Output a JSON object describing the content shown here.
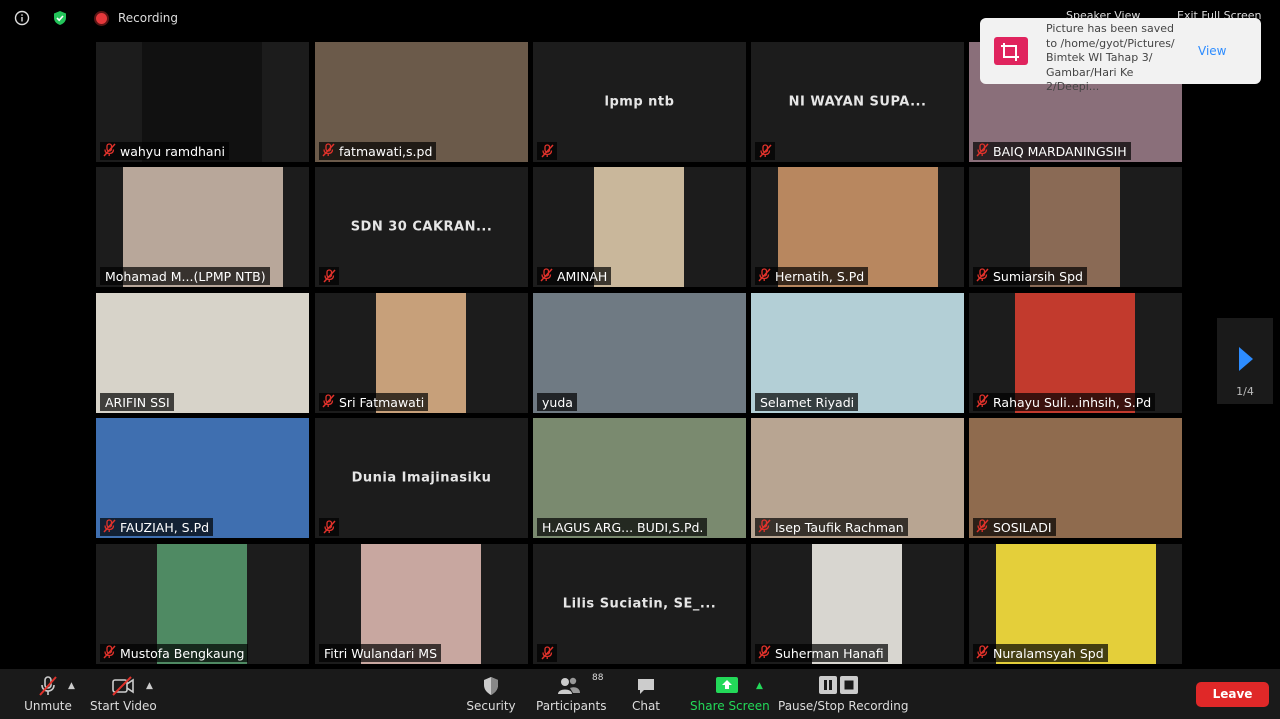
{
  "topbar": {
    "recording_label": "Recording",
    "speaker_view_label": "Speaker View",
    "exit_fullscreen_label": "Exit Full Screen"
  },
  "toast": {
    "message": "Picture has been saved to /home/gyot/Pictures/ Bimtek WI Tahap 3/ Gambar/Hari Ke 2/Deepi...",
    "view_label": "View"
  },
  "pagination": {
    "label": "1/4"
  },
  "participants": [
    {
      "name": "wahyu ramdhani",
      "muted": true
    },
    {
      "name": "fatmawati,s.pd",
      "muted": true
    },
    {
      "name": "",
      "center_name": "lpmp ntb",
      "muted": true
    },
    {
      "name": "",
      "center_name": "NI WAYAN SUPA...",
      "muted": true
    },
    {
      "name": "BAIQ MARDANINGSIH",
      "muted": true
    },
    {
      "name": "Mohamad M...(LPMP NTB)",
      "muted": false
    },
    {
      "name": "",
      "center_name": "SDN 30 CAKRAN...",
      "muted": true
    },
    {
      "name": "AMINAH",
      "muted": true
    },
    {
      "name": "Hernatih, S.Pd",
      "muted": true
    },
    {
      "name": "Sumiarsih Spd",
      "muted": true
    },
    {
      "name": "ARIFIN SSI",
      "muted": false
    },
    {
      "name": "Sri Fatmawati",
      "muted": true
    },
    {
      "name": "yuda",
      "muted": false
    },
    {
      "name": "Selamet Riyadi",
      "muted": false,
      "active_speaker": true
    },
    {
      "name": "Rahayu Suli...inhsih, S.Pd",
      "muted": true
    },
    {
      "name": "FAUZIAH, S.Pd",
      "muted": true
    },
    {
      "name": "",
      "center_name": "Dunia Imajinasiku",
      "muted": true
    },
    {
      "name": "H.AGUS ARG... BUDI,S.Pd.",
      "muted": false
    },
    {
      "name": "Isep Taufik Rachman",
      "muted": true
    },
    {
      "name": "SOSILADI",
      "muted": true
    },
    {
      "name": "Mustofa Bengkaung",
      "muted": true
    },
    {
      "name": "Fitri Wulandari MS",
      "muted": false
    },
    {
      "name": "",
      "center_name": "Lilis Suciatin, SE_...",
      "muted": true
    },
    {
      "name": "Suherman Hanafi",
      "muted": true
    },
    {
      "name": "Nuralamsyah Spd",
      "muted": true
    }
  ],
  "toolbar": {
    "unmute": "Unmute",
    "start_video": "Start Video",
    "security": "Security",
    "participants": "Participants",
    "participants_count": "88",
    "chat": "Chat",
    "share_screen": "Share Screen",
    "pause_stop_recording": "Pause/Stop Recording",
    "leave": "Leave"
  },
  "colors": {
    "share_green": "#23d959",
    "leave_red": "#e02828",
    "talking_border": "#f1e41a",
    "mute_red": "#e0322b"
  }
}
